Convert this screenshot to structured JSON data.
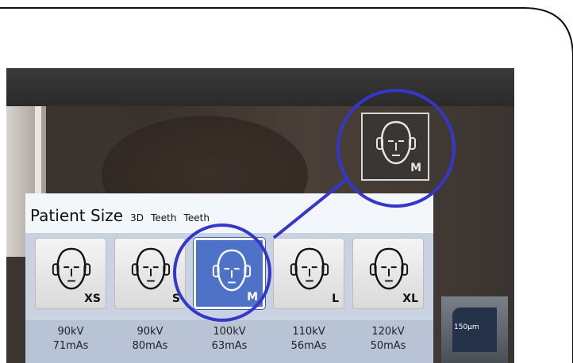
{
  "panel": {
    "title": "Patient Size",
    "modes": [
      "3D",
      "Teeth",
      "Teeth"
    ]
  },
  "sizes": [
    {
      "label": "XS",
      "kv": "90kV",
      "mas": "71mAs",
      "selected": false
    },
    {
      "label": "S",
      "kv": "90kV",
      "mas": "80mAs",
      "selected": false
    },
    {
      "label": "M",
      "kv": "100kV",
      "mas": "63mAs",
      "selected": true
    },
    {
      "label": "L",
      "kv": "110kV",
      "mas": "56mAs",
      "selected": false
    },
    {
      "label": "XL",
      "kv": "120kV",
      "mas": "50mAs",
      "selected": false
    }
  ],
  "indicator": {
    "label": "M"
  },
  "right_widget": {
    "label": "150µm"
  },
  "colors": {
    "accent": "#4f72c9",
    "ring": "#3437c9"
  }
}
